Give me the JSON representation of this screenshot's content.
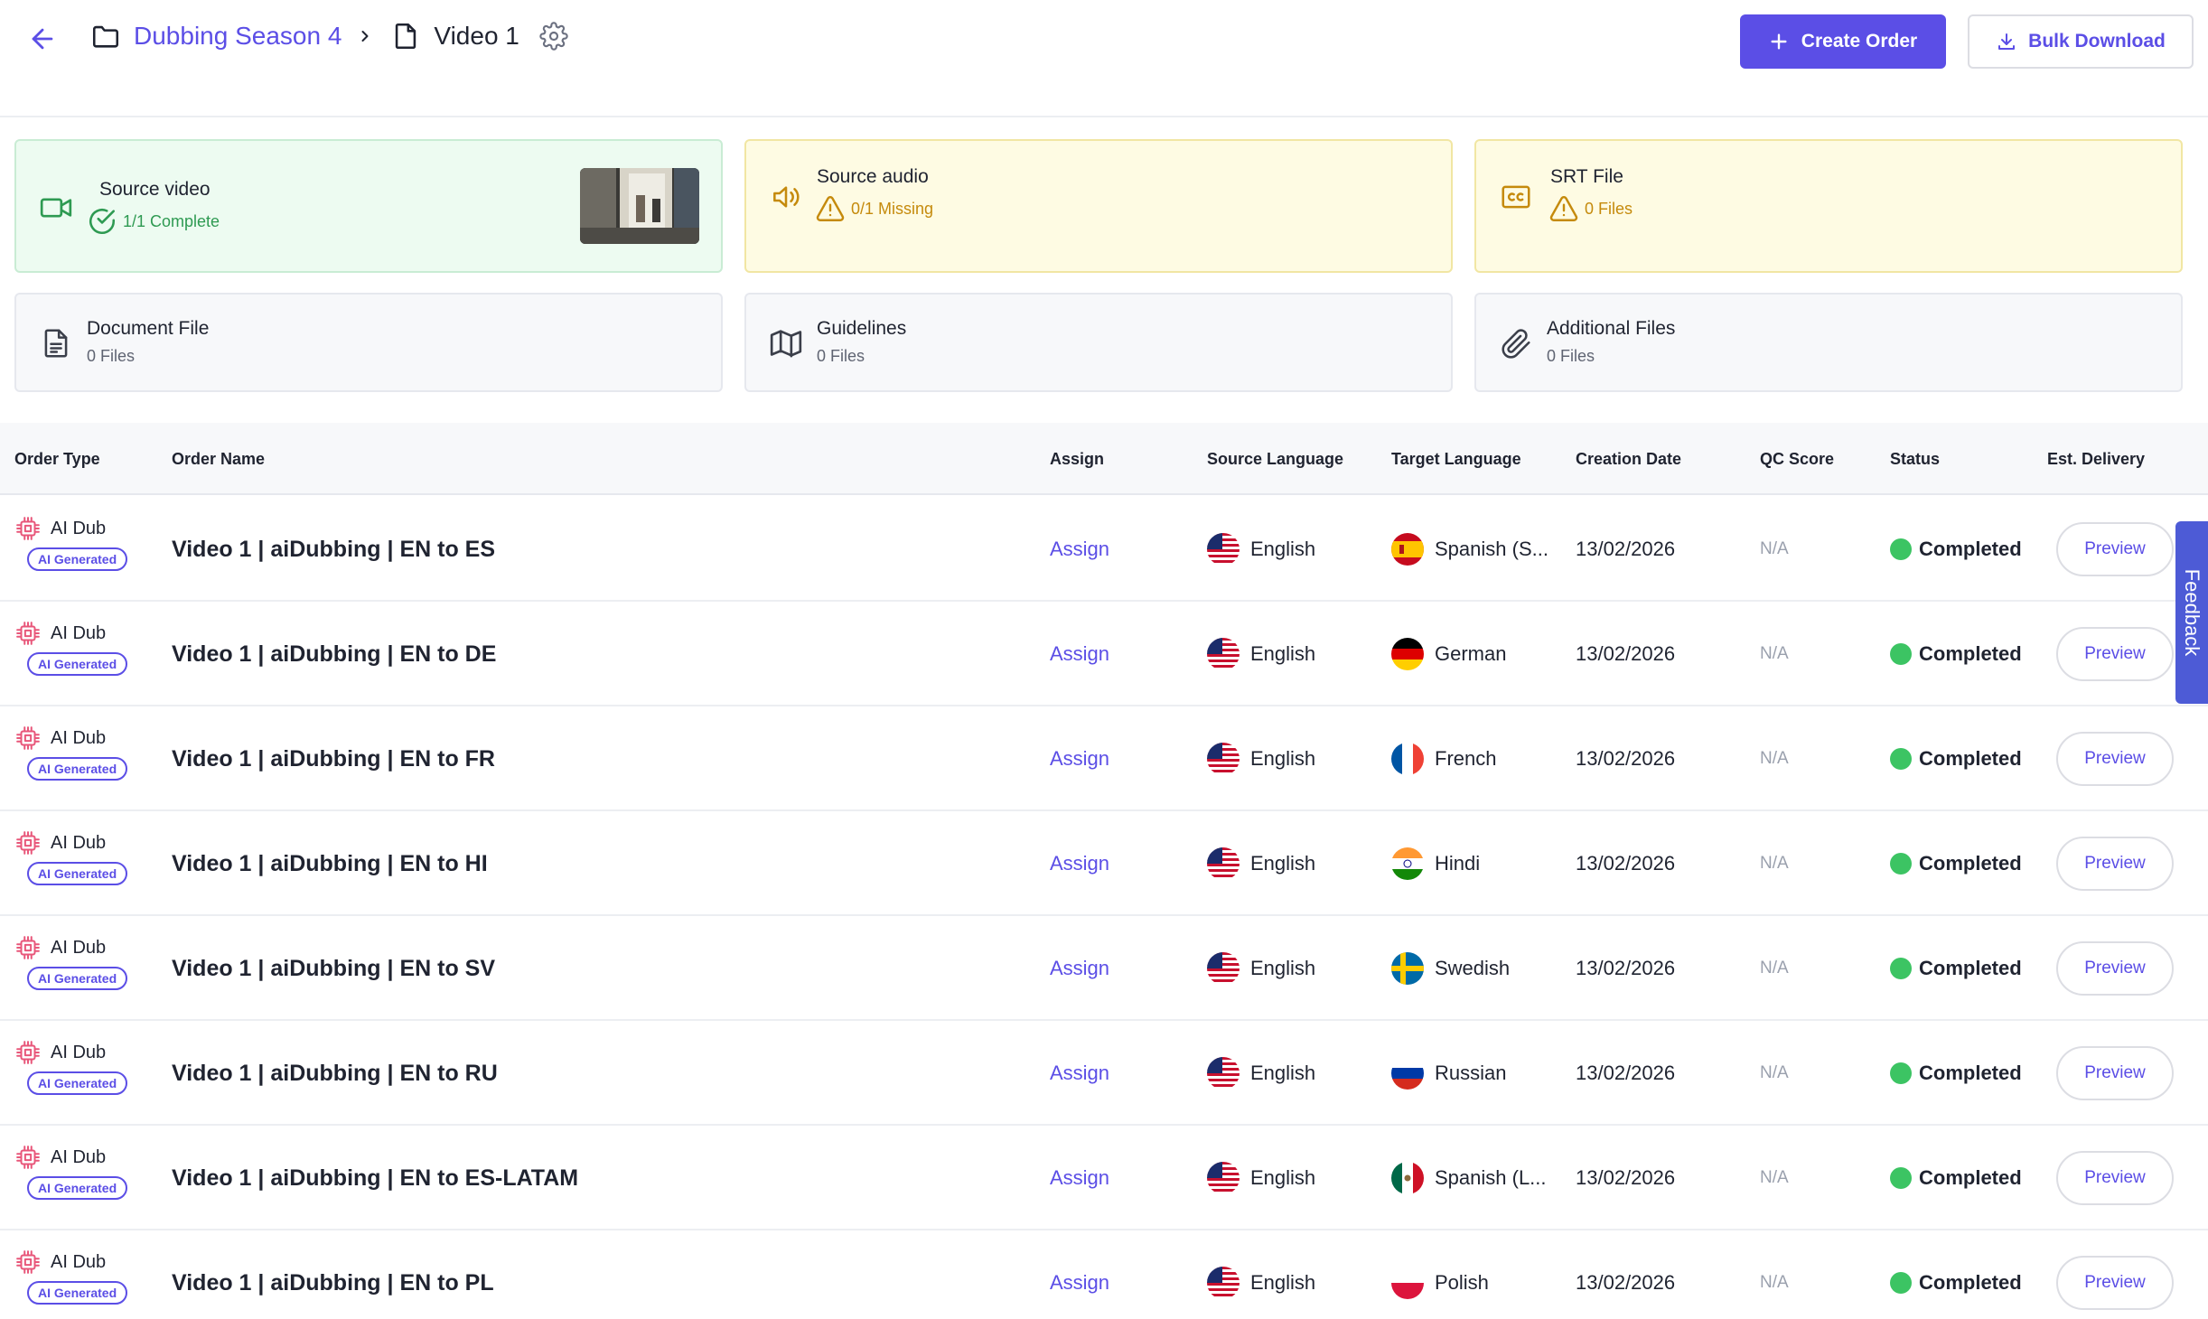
{
  "header": {
    "folder_name": "Dubbing Season 4",
    "file_name": "Video 1",
    "create_order_label": "Create Order",
    "bulk_download_label": "Bulk Download"
  },
  "cards": {
    "source_video": {
      "title": "Source video",
      "status": "1/1 Complete"
    },
    "source_audio": {
      "title": "Source audio",
      "status": "0/1 Missing"
    },
    "srt_file": {
      "title": "SRT File",
      "status": "0 Files"
    },
    "document_file": {
      "title": "Document File",
      "status": "0 Files"
    },
    "guidelines": {
      "title": "Guidelines",
      "status": "0 Files"
    },
    "additional_files": {
      "title": "Additional Files",
      "status": "0 Files"
    }
  },
  "table": {
    "columns": [
      "Order Type",
      "Order Name",
      "Assign",
      "Source Language",
      "Target Language",
      "Creation Date",
      "QC Score",
      "Status",
      "Est. Delivery"
    ],
    "rows": [
      {
        "type": "AI Dub",
        "badge": "AI Generated",
        "name": "Video 1 | aiDubbing | EN to ES",
        "assign": "Assign",
        "source": "English",
        "target": "Spanish (S...",
        "flag": "es",
        "date": "13/02/2026",
        "qc": "N/A",
        "status": "Completed",
        "action": "Preview"
      },
      {
        "type": "AI Dub",
        "badge": "AI Generated",
        "name": "Video 1 | aiDubbing | EN to DE",
        "assign": "Assign",
        "source": "English",
        "target": "German",
        "flag": "de",
        "date": "13/02/2026",
        "qc": "N/A",
        "status": "Completed",
        "action": "Preview"
      },
      {
        "type": "AI Dub",
        "badge": "AI Generated",
        "name": "Video 1 | aiDubbing | EN to FR",
        "assign": "Assign",
        "source": "English",
        "target": "French",
        "flag": "fr",
        "date": "13/02/2026",
        "qc": "N/A",
        "status": "Completed",
        "action": "Preview"
      },
      {
        "type": "AI Dub",
        "badge": "AI Generated",
        "name": "Video 1 | aiDubbing | EN to HI",
        "assign": "Assign",
        "source": "English",
        "target": "Hindi",
        "flag": "in",
        "date": "13/02/2026",
        "qc": "N/A",
        "status": "Completed",
        "action": "Preview"
      },
      {
        "type": "AI Dub",
        "badge": "AI Generated",
        "name": "Video 1 | aiDubbing | EN to SV",
        "assign": "Assign",
        "source": "English",
        "target": "Swedish",
        "flag": "se",
        "date": "13/02/2026",
        "qc": "N/A",
        "status": "Completed",
        "action": "Preview"
      },
      {
        "type": "AI Dub",
        "badge": "AI Generated",
        "name": "Video 1 | aiDubbing | EN to RU",
        "assign": "Assign",
        "source": "English",
        "target": "Russian",
        "flag": "ru",
        "date": "13/02/2026",
        "qc": "N/A",
        "status": "Completed",
        "action": "Preview"
      },
      {
        "type": "AI Dub",
        "badge": "AI Generated",
        "name": "Video 1 | aiDubbing | EN to ES-LATAM",
        "assign": "Assign",
        "source": "English",
        "target": "Spanish (L...",
        "flag": "mx",
        "date": "13/02/2026",
        "qc": "N/A",
        "status": "Completed",
        "action": "Preview"
      },
      {
        "type": "AI Dub",
        "badge": "AI Generated",
        "name": "Video 1 | aiDubbing | EN to PL",
        "assign": "Assign",
        "source": "English",
        "target": "Polish",
        "flag": "pl",
        "date": "13/02/2026",
        "qc": "N/A",
        "status": "Completed",
        "action": "Preview"
      }
    ]
  },
  "feedback_label": "Feedback",
  "icons": {
    "back": "arrow-left-icon",
    "folder": "folder-icon",
    "file": "file-icon",
    "settings": "gear-icon",
    "plus": "plus-icon",
    "download": "download-icon",
    "video": "video-camera-icon",
    "audio": "speaker-icon",
    "captions": "closed-captions-icon",
    "document": "document-icon",
    "map": "map-icon",
    "paperclip": "paperclip-icon",
    "check": "check-circle-icon",
    "warning": "warning-triangle-icon",
    "chip": "chip-icon"
  },
  "colors": {
    "accent": "#5b4ee6",
    "success": "#3cc463",
    "warning": "#c58a0c",
    "card_green_bg": "#edfbf1",
    "card_yellow_bg": "#fefbe3",
    "ai_chip": "#e8577a",
    "feedback_tab": "#4d5bd6"
  }
}
